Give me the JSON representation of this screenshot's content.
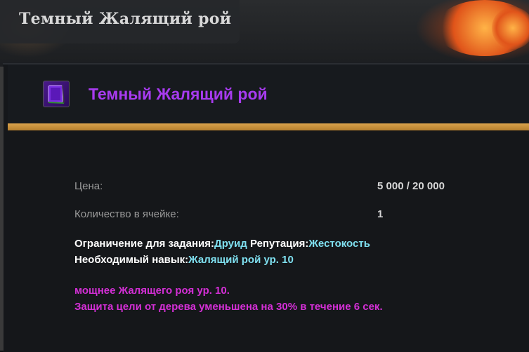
{
  "window": {
    "title": "Темный Жалящий рой"
  },
  "item": {
    "icon": "purple-book-icon",
    "name": "Темный Жалящий рой",
    "name_color": "#a83bf0"
  },
  "stats": {
    "price_label": "Цена:",
    "price_value": "5 000 / 20 000",
    "stack_label": "Количество в ячейке:",
    "stack_value": "1"
  },
  "requirements": {
    "quest_restriction_label": "Ограничение для задания:",
    "quest_restriction_value": "Друид",
    "reputation_label": "Репутация:",
    "reputation_value": "Жестокость",
    "skill_label": "Необходимый навык:",
    "skill_value": "Жалящий рой ур. 10"
  },
  "description": {
    "line1": "мощнее Жалящего роя ур. 10.",
    "line2": "Защита цели от дерева уменьшена на 30% в течение 6 сек.",
    "color": "#d42fd6"
  },
  "colors": {
    "accent_gold": "#d9a24c",
    "highlight_cyan": "#7fe0f0"
  }
}
